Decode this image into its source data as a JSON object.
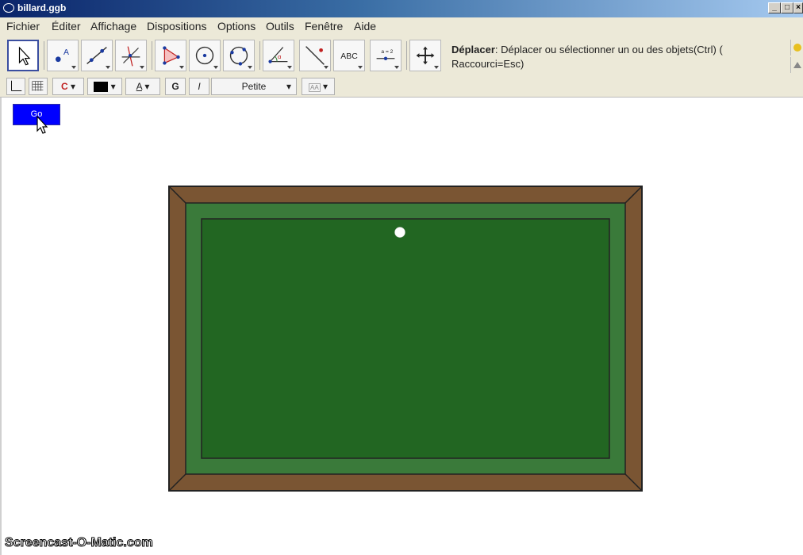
{
  "window": {
    "title": "billard.ggb",
    "controls": [
      "_",
      "□",
      "×"
    ]
  },
  "menu": {
    "items": [
      "Fichier",
      "Éditer",
      "Affichage",
      "Dispositions",
      "Options",
      "Outils",
      "Fenêtre",
      "Aide"
    ]
  },
  "toolbar": {
    "tools": [
      {
        "icon": "move-arrow-icon",
        "active": true
      },
      {
        "icon": "point-icon"
      },
      {
        "icon": "line-icon"
      },
      {
        "icon": "perpendicular-icon"
      },
      {
        "icon": "polygon-icon"
      },
      {
        "icon": "circle-center-icon"
      },
      {
        "icon": "circle-three-points-icon"
      },
      {
        "icon": "angle-icon"
      },
      {
        "icon": "reflect-icon"
      },
      {
        "icon": "text-abc-icon",
        "label": "ABC"
      },
      {
        "icon": "slider-icon",
        "label": "a = 2"
      },
      {
        "icon": "move-view-icon"
      }
    ],
    "help_title": "Déplacer",
    "help_text": ": Déplacer ou sélectionner un ou des objets(Ctrl) (",
    "help_text_2": "Raccourci=Esc)"
  },
  "stylebar": {
    "bold": "G",
    "italic": "I",
    "size": "Petite",
    "label_style": "A",
    "text_size_icon": "AA",
    "magnet_icon": "C"
  },
  "canvas": {
    "button_label": "Go",
    "watermark": "Screencast-O-Matic.com",
    "colors": {
      "frame": "#7a5533",
      "cushion": "#3a7a3a",
      "felt": "#226622",
      "ball": "#ffffff",
      "button": "#0000ff"
    }
  }
}
